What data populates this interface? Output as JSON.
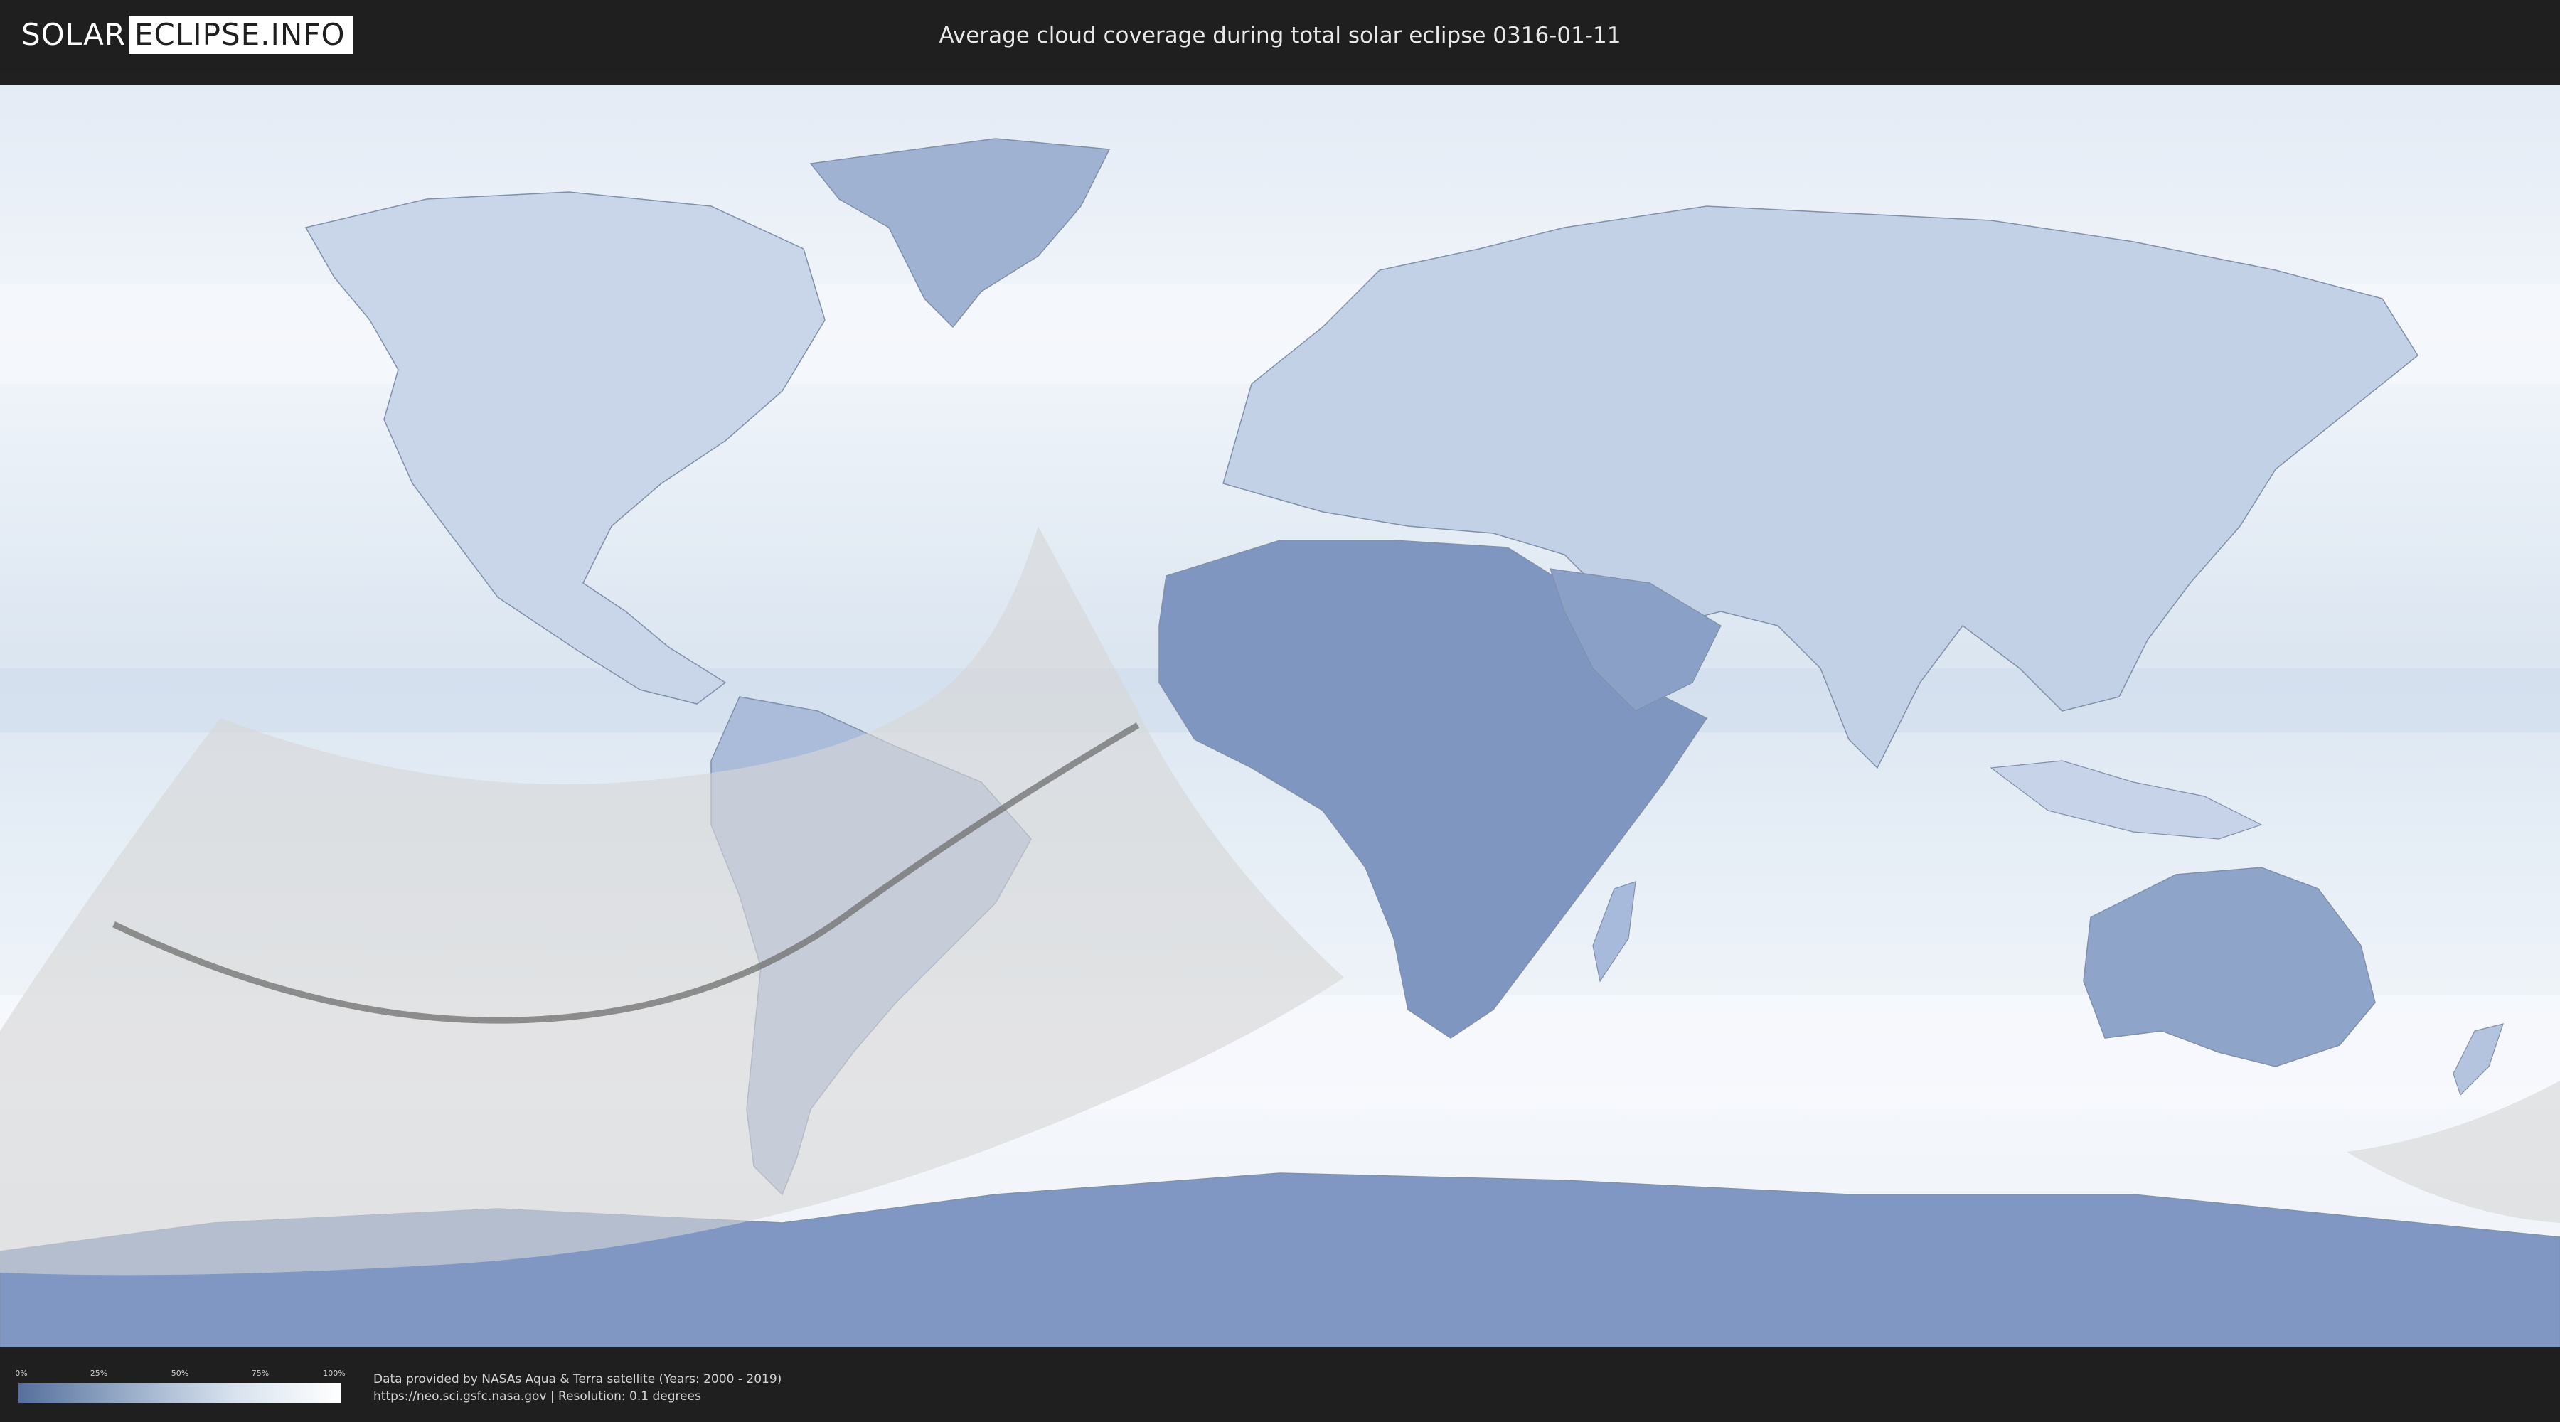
{
  "header": {
    "logo_left": "SOLAR",
    "logo_right": "ECLIPSE.INFO",
    "title": "Average cloud coverage during total solar eclipse 0316-01-11"
  },
  "legend": {
    "ticks": [
      "0%",
      "25%",
      "50%",
      "75%",
      "100%"
    ],
    "gradient_colors": [
      "#56709d",
      "#98acc8",
      "#d8e2ee",
      "#ffffff"
    ]
  },
  "credits": {
    "line1": "Data provided by NASAs Aqua & Terra satellite (Years: 2000 - 2019)",
    "line2": "https://neo.sci.gsfc.nasa.gov | Resolution: 0.1 degrees"
  },
  "colors": {
    "ocean": "#e9eff7",
    "land_cloudy": "#c7d5e8",
    "land_clear": "#7f96c0",
    "eclipse_overlay": "#d6d6d6",
    "eclipse_path": "#6f6f6f"
  }
}
